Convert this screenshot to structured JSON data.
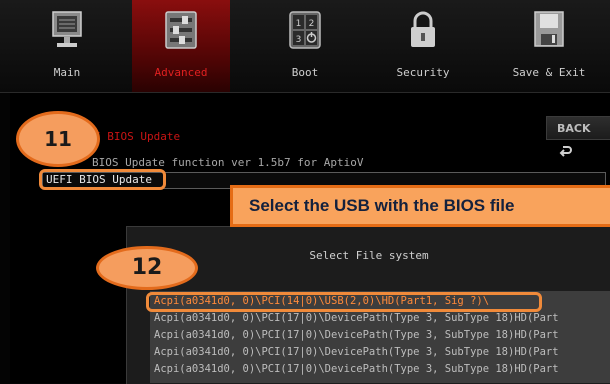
{
  "nav": {
    "tabs": [
      {
        "label": "Main",
        "icon": "monitor-icon"
      },
      {
        "label": "Advanced",
        "icon": "sliders-icon"
      },
      {
        "label": "Boot",
        "icon": "boot-grid-icon"
      },
      {
        "label": "Security",
        "icon": "padlock-icon"
      },
      {
        "label": "Save & Exit",
        "icon": "floppy-disk-icon"
      }
    ],
    "active": "Advanced"
  },
  "page": {
    "title": "I BIOS Update",
    "back_label": "BACK",
    "description": "BIOS Update function ver 1.5b7 for AptioV",
    "selected_option": "UEFI BIOS Update"
  },
  "annotations": {
    "step11": "11",
    "step12": "12",
    "banner": "Select the USB with the BIOS file"
  },
  "dialog": {
    "title": "Select File system",
    "items": [
      "Acpi(a0341d0, 0)\\PCI(14|0)\\USB(2,0)\\HD(Part1, Sig ?)\\",
      "Acpi(a0341d0, 0)\\PCI(17|0)\\DevicePath(Type 3, SubType 18)HD(Part",
      "Acpi(a0341d0, 0)\\PCI(17|0)\\DevicePath(Type 3, SubType 18)HD(Part",
      "Acpi(a0341d0, 0)\\PCI(17|0)\\DevicePath(Type 3, SubType 18)HD(Part",
      "Acpi(a0341d0, 0)\\PCI(17|0)\\DevicePath(Type 3, SubType 18)HD(Part"
    ],
    "selected_index": 0
  },
  "colors": {
    "accent_red": "#c81414",
    "annotation_orange": "#f59d5e",
    "annotation_border": "#e36b1c",
    "highlight_text": "#ff8a3a"
  }
}
